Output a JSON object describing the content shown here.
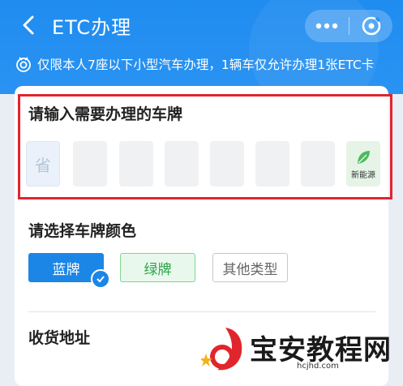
{
  "header": {
    "title": "ETC办理",
    "back_icon": "chevron-left-icon",
    "more_icon": "more-dots-icon",
    "close_icon": "target-close-icon",
    "background": "#2a93f2"
  },
  "notice": {
    "icon": "bell-icon",
    "text": "仅限本人7座以下小型汽车办理，1辆车仅允许办理1张ETC卡"
  },
  "plate": {
    "heading": "请输入需要办理的车牌",
    "province_placeholder": "省",
    "new_energy_label": "新能源",
    "new_energy_icon": "leaf-icon",
    "highlight_color": "#e2242f"
  },
  "plate_color": {
    "heading": "请选择车牌颜色",
    "options": [
      {
        "label": "蓝牌",
        "selected": true,
        "color": "#1b86e6"
      },
      {
        "label": "绿牌",
        "selected": false,
        "color": "#2aa44a"
      },
      {
        "label": "其他类型",
        "selected": false,
        "color": "#666666"
      }
    ]
  },
  "delivery": {
    "heading": "收货地址"
  },
  "watermark": {
    "text": "宝安教程网",
    "url": "hcjhd.com"
  }
}
